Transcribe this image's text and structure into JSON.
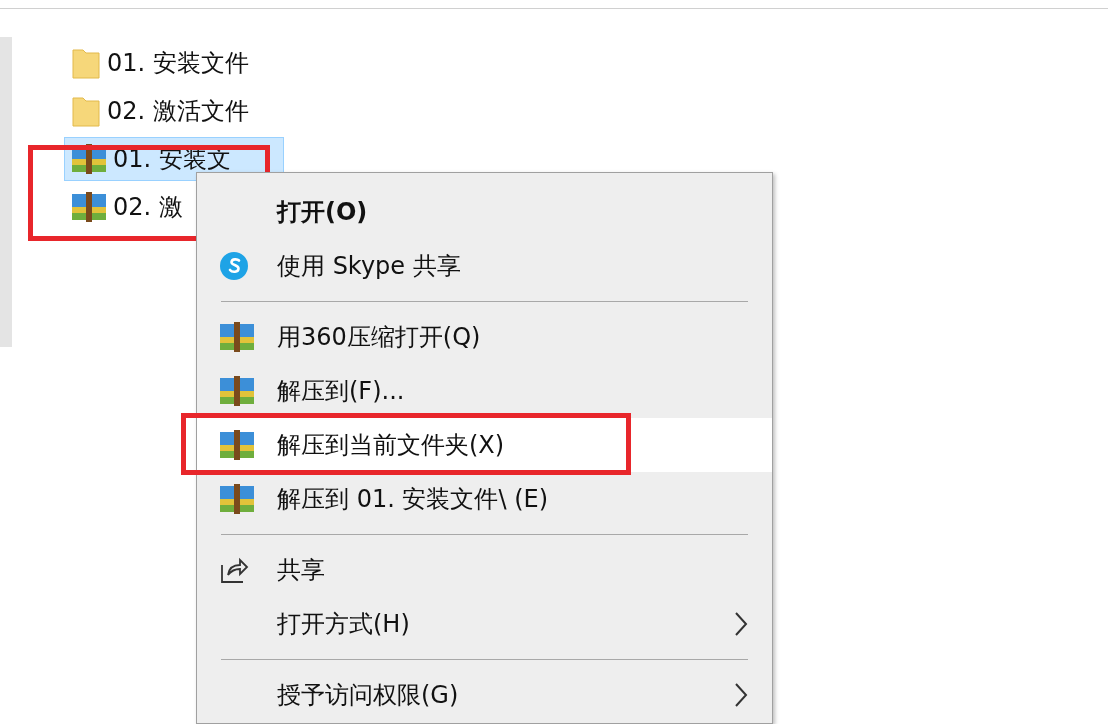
{
  "files": [
    {
      "name": "01. 安装文件",
      "kind": "folder",
      "selected": false,
      "annotated": false
    },
    {
      "name": "02. 激活文件",
      "kind": "folder",
      "selected": false,
      "annotated": false
    },
    {
      "name": "01. 安装文",
      "kind": "archive",
      "selected": true,
      "annotated": true
    },
    {
      "name": "02. 激",
      "kind": "archive",
      "selected": false,
      "annotated": true
    }
  ],
  "context_menu": {
    "items": [
      {
        "kind": "plain",
        "label": "打开(O)",
        "default": true,
        "submenu": false,
        "selected": false,
        "annotated": false
      },
      {
        "kind": "skype",
        "label": "使用 Skype 共享",
        "default": false,
        "submenu": false,
        "selected": false,
        "annotated": false
      },
      {
        "kind": "separator"
      },
      {
        "kind": "archive",
        "label": "用360压缩打开(Q)",
        "default": false,
        "submenu": false,
        "selected": false,
        "annotated": false
      },
      {
        "kind": "archive",
        "label": "解压到(F)...",
        "default": false,
        "submenu": false,
        "selected": false,
        "annotated": false
      },
      {
        "kind": "archive",
        "label": "解压到当前文件夹(X)",
        "default": false,
        "submenu": false,
        "selected": true,
        "annotated": true
      },
      {
        "kind": "archive",
        "label": "解压到 01. 安装文件\\ (E)",
        "default": false,
        "submenu": false,
        "selected": false,
        "annotated": false
      },
      {
        "kind": "separator"
      },
      {
        "kind": "share",
        "label": "共享",
        "default": false,
        "submenu": false,
        "selected": false,
        "annotated": false
      },
      {
        "kind": "plain",
        "label": "打开方式(H)",
        "default": false,
        "submenu": true,
        "selected": false,
        "annotated": false
      },
      {
        "kind": "separator"
      },
      {
        "kind": "plain",
        "label": "授予访问权限(G)",
        "default": false,
        "submenu": true,
        "selected": false,
        "annotated": false
      }
    ]
  }
}
